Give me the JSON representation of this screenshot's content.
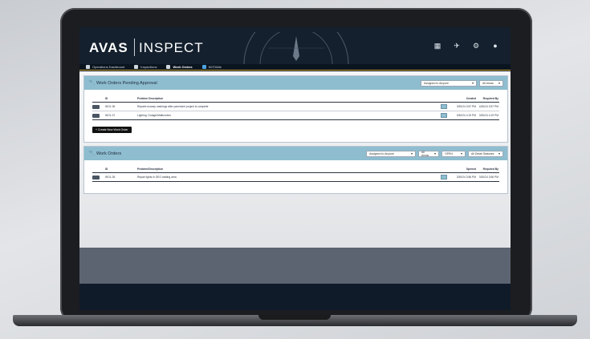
{
  "brand": {
    "mark": "AVAS",
    "name": "INSPECT"
  },
  "top_icons": [
    "grid-icon",
    "satellite-icon",
    "gear-icon",
    "user-icon"
  ],
  "nav": [
    {
      "label": "Operations Dashboard",
      "icon": "monitor-icon",
      "active": false
    },
    {
      "label": "Inspections",
      "icon": "clipboard-icon",
      "active": false
    },
    {
      "label": "Work Orders",
      "icon": "wrench-icon",
      "active": true
    },
    {
      "label": "NOTAMs",
      "icon": "message-icon",
      "active": false
    }
  ],
  "pending": {
    "title": "Work Orders Pending Approval",
    "filters": [
      "Assigned to Anyone",
      "All Areas"
    ],
    "columns": {
      "id": "ID",
      "desc": "Problem Description",
      "created": "Created",
      "required": "Required By"
    },
    "rows": [
      {
        "id": "WO1-36",
        "desc": "Repaint runway markings after pavement project is complete",
        "created": "3/30/24 3:57 PM",
        "required": "4/30/24 3:57 PM"
      },
      {
        "id": "WO1-37",
        "desc": "Lighting: Outage/Malfunction",
        "created": "3/30/24 4:19 PM",
        "required": "3/30/24 4:19 PM"
      }
    ],
    "create_label": "+ Create New Work Order"
  },
  "work_orders": {
    "title": "Work Orders",
    "filters": [
      "Assigned to Anyone",
      "All Areas",
      "OPEN",
      "All Detail Statuses"
    ],
    "columns": {
      "id": "ID",
      "desc": "Problem/Description",
      "created": "Opened",
      "required": "Required By"
    },
    "rows": [
      {
        "id": "WO1-35",
        "desc": "Repair lights in GEO waiting area",
        "created": "3/30/24 3:56 PM",
        "required": "3/30/24 3:56 PM"
      }
    ]
  },
  "colors": {
    "accent": "#8ebdd0",
    "header": "#14202e",
    "nav_underline": "#c9a227"
  }
}
